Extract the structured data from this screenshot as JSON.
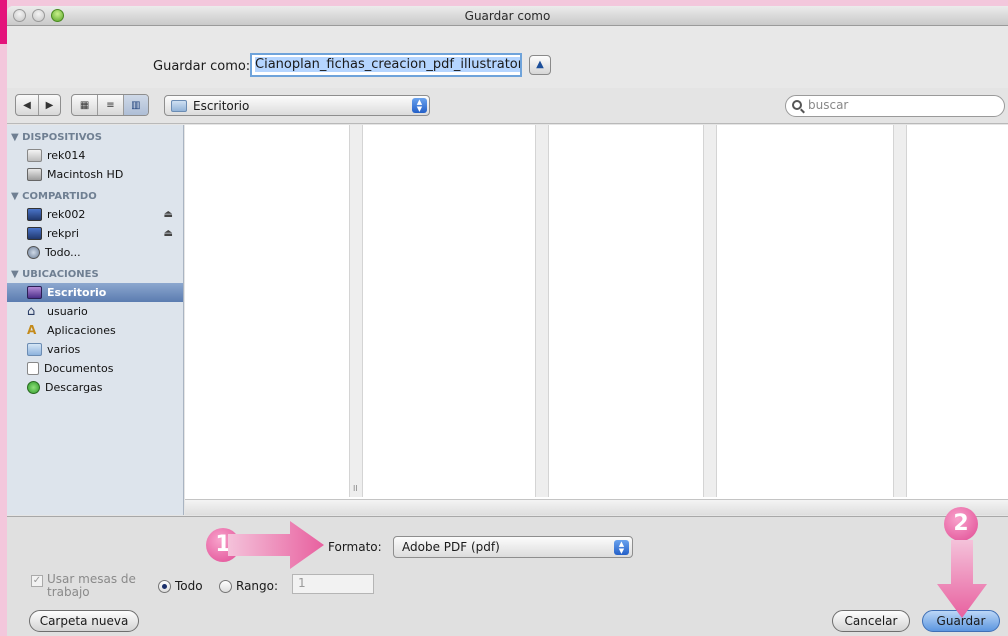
{
  "window": {
    "title": "Guardar como"
  },
  "header": {
    "save_label": "Guardar como:",
    "filename": "Cianoplan_fichas_creacion_pdf_illustrator."
  },
  "toolbar": {
    "location": "Escritorio",
    "search_placeholder": "buscar"
  },
  "sidebar": {
    "sections": [
      {
        "heading": "▼ DISPOSITIVOS",
        "items": [
          "rek014",
          "Macintosh HD"
        ]
      },
      {
        "heading": "▼ COMPARTIDO",
        "items": [
          "rek002",
          "rekpri",
          "Todo..."
        ]
      },
      {
        "heading": "▼ UBICACIONES",
        "items": [
          "Escritorio",
          "usuario",
          "Aplicaciones",
          "varios",
          "Documentos",
          "Descargas"
        ]
      }
    ]
  },
  "options": {
    "format_label": "Formato:",
    "format_value": "Adobe PDF (pdf)",
    "artboards_label": "Usar mesas de trabajo",
    "all_label": "Todo",
    "range_label": "Rango:",
    "range_value": "1"
  },
  "buttons": {
    "new_folder": "Carpeta nueva",
    "cancel": "Cancelar",
    "save": "Guardar"
  },
  "annotations": {
    "step1": "1",
    "step2": "2"
  },
  "colors": {
    "accent": "#e4137b",
    "selection": "#5b7cb0",
    "default_button": "#5c96e0"
  }
}
